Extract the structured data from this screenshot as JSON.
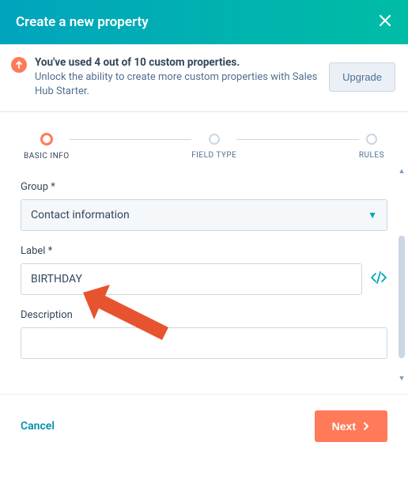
{
  "header": {
    "title": "Create a new property"
  },
  "banner": {
    "bold": "You've used 4 out of 10 custom properties.",
    "text": "Unlock the ability to create more custom properties with Sales Hub Starter.",
    "upgrade_label": "Upgrade"
  },
  "stepper": {
    "steps": [
      {
        "label": "BASIC INFO",
        "active": true
      },
      {
        "label": "FIELD TYPE",
        "active": false
      },
      {
        "label": "RULES",
        "active": false
      }
    ]
  },
  "form": {
    "group_label": "Group *",
    "group_value": "Contact information",
    "label_label": "Label *",
    "label_value": "BIRTHDAY",
    "description_label": "Description",
    "description_value": ""
  },
  "footer": {
    "cancel": "Cancel",
    "next": "Next"
  }
}
